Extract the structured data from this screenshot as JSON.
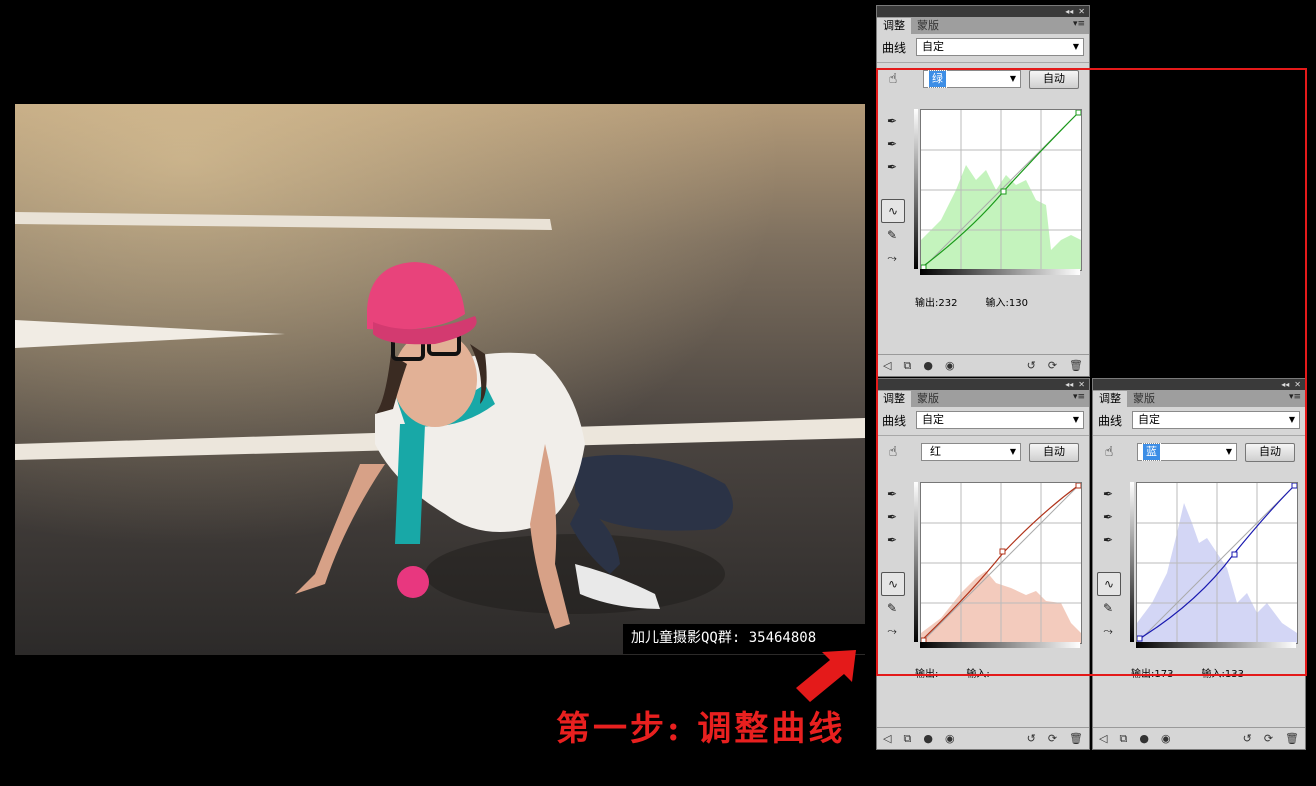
{
  "photo": {
    "watermark": "加儿童摄影QQ群: 35464808"
  },
  "caption": "第一步: 调整曲线",
  "panels": [
    {
      "tabs": [
        "调整",
        "蒙版"
      ],
      "preset_label": "曲线",
      "preset_value": "自定",
      "channel": "绿",
      "auto_label": "自动",
      "output_label": "输出:",
      "output_value": "232",
      "input_label": "输入:",
      "input_value": "130",
      "curve_color": "#1a9a1a",
      "hist_color": "#c4f3bd"
    },
    {
      "tabs": [
        "调整",
        "蒙版"
      ],
      "preset_label": "曲线",
      "preset_value": "自定",
      "channel": "红",
      "auto_label": "自动",
      "output_label": "输出:",
      "output_value": "",
      "input_label": "输入:",
      "input_value": "",
      "curve_color": "#b0331a",
      "hist_color": "#f3cbbd"
    },
    {
      "tabs": [
        "调整",
        "蒙版"
      ],
      "preset_label": "曲线",
      "preset_value": "自定",
      "channel": "蓝",
      "auto_label": "自动",
      "output_label": "输出:",
      "output_value": "173",
      "input_label": "输入:",
      "input_value": "133",
      "curve_color": "#1a1ab0",
      "hist_color": "#d3d6f5"
    }
  ],
  "icons": [
    "targeted-adjust-icon",
    "black-eyedropper-icon",
    "gray-eyedropper-icon",
    "white-eyedropper-icon",
    "curve-edit-icon",
    "pencil-icon",
    "smooth-icon",
    "back-icon",
    "clip-icon",
    "layer-visibility-icon",
    "eye-icon",
    "previous-state-icon",
    "reset-icon",
    "trash-icon"
  ]
}
